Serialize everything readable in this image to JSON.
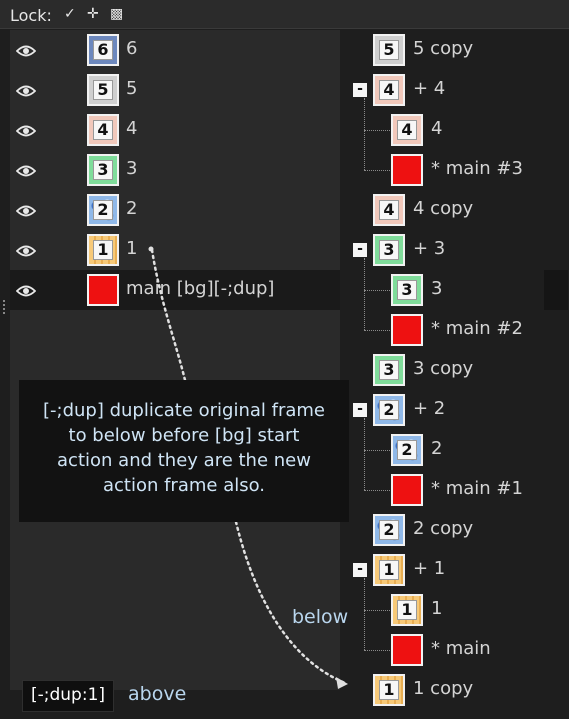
{
  "lock": {
    "label": "Lock:",
    "icons": [
      "pencil-icon",
      "move-icon",
      "checker-icon"
    ]
  },
  "icons": {
    "pencil": "✓",
    "move": "✛",
    "checker": "▩"
  },
  "layers_left": [
    {
      "name": "6",
      "number": "6",
      "thumb": "blue"
    },
    {
      "name": "5",
      "number": "5",
      "thumb": "gray"
    },
    {
      "name": "4",
      "number": "4",
      "thumb": "pink"
    },
    {
      "name": "3",
      "number": "3",
      "thumb": "green"
    },
    {
      "name": "2",
      "number": "2",
      "thumb": "water"
    },
    {
      "name": "1",
      "number": "1",
      "thumb": "orange"
    },
    {
      "name": "main [bg][-;dup]",
      "number": "",
      "thumb": "red"
    }
  ],
  "layers_right": [
    {
      "name": "5 copy",
      "number": "5",
      "thumb": "gray",
      "group": false,
      "child": false
    },
    {
      "name": "+ 4",
      "number": "4",
      "thumb": "pink",
      "group": true,
      "child": false
    },
    {
      "name": "4",
      "number": "4",
      "thumb": "pink",
      "group": false,
      "child": true
    },
    {
      "name": "* main #3",
      "number": "",
      "thumb": "red",
      "group": false,
      "child": true
    },
    {
      "name": "4 copy",
      "number": "4",
      "thumb": "pink",
      "group": false,
      "child": false
    },
    {
      "name": "+ 3",
      "number": "3",
      "thumb": "green",
      "group": true,
      "child": false
    },
    {
      "name": "3",
      "number": "3",
      "thumb": "green",
      "group": false,
      "child": true
    },
    {
      "name": "* main #2",
      "number": "",
      "thumb": "red",
      "group": false,
      "child": true
    },
    {
      "name": "3 copy",
      "number": "3",
      "thumb": "green",
      "group": false,
      "child": false
    },
    {
      "name": "+ 2",
      "number": "2",
      "thumb": "water",
      "group": true,
      "child": false
    },
    {
      "name": "2",
      "number": "2",
      "thumb": "water",
      "group": false,
      "child": true
    },
    {
      "name": "* main #1",
      "number": "",
      "thumb": "red",
      "group": false,
      "child": true
    },
    {
      "name": "2 copy",
      "number": "2",
      "thumb": "water",
      "group": false,
      "child": false
    },
    {
      "name": "+ 1",
      "number": "1",
      "thumb": "orange",
      "group": true,
      "child": false
    },
    {
      "name": "1",
      "number": "1",
      "thumb": "orange",
      "group": false,
      "child": true
    },
    {
      "name": "* main",
      "number": "",
      "thumb": "red",
      "group": false,
      "child": true
    },
    {
      "name": "1 copy",
      "number": "1",
      "thumb": "orange",
      "group": false,
      "child": false
    }
  ],
  "group_toggle": "-",
  "tooltip": {
    "lines": [
      "[-;dup]  duplicate original frame",
      "to below before [bg] start",
      "action and they are the new",
      "action frame also."
    ]
  },
  "annotations": {
    "below": "below",
    "above": "above",
    "dup_tag": "[-;dup:1]"
  }
}
